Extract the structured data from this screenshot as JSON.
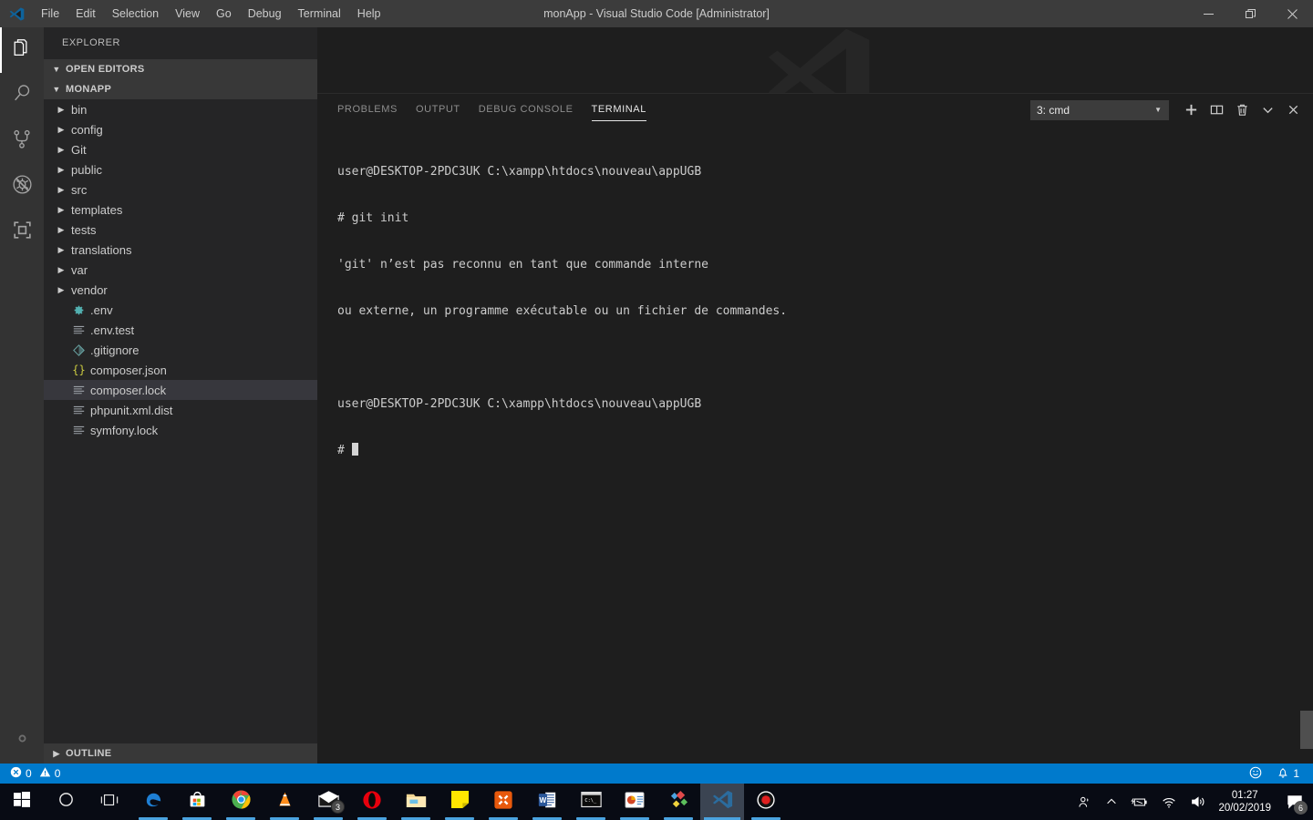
{
  "titlebar": {
    "title": "monApp - Visual Studio Code [Administrator]",
    "logo_icon": "vscode-logo-icon",
    "menu": [
      {
        "label": "File"
      },
      {
        "label": "Edit"
      },
      {
        "label": "Selection"
      },
      {
        "label": "View"
      },
      {
        "label": "Go"
      },
      {
        "label": "Debug"
      },
      {
        "label": "Terminal"
      },
      {
        "label": "Help"
      }
    ],
    "window_controls": [
      {
        "name": "minimize-button",
        "glyph": "—"
      },
      {
        "name": "maximize-button",
        "glyph": "❐"
      },
      {
        "name": "close-button",
        "glyph": "✕"
      }
    ]
  },
  "activitybar": {
    "items": [
      {
        "name": "explorer",
        "icon": "files-icon",
        "active": true
      },
      {
        "name": "search",
        "icon": "search-icon",
        "active": false
      },
      {
        "name": "source-control",
        "icon": "source-control-icon",
        "active": false
      },
      {
        "name": "debug",
        "icon": "debug-disabled-icon",
        "active": false
      },
      {
        "name": "extensions",
        "icon": "extensions-icon",
        "active": false
      }
    ],
    "settings": {
      "name": "manage-settings",
      "icon": "gear-icon"
    }
  },
  "sidebar": {
    "title": "EXPLORER",
    "open_editors_label": "OPEN EDITORS",
    "project_label": "MONAPP",
    "outline_label": "OUTLINE",
    "tree": [
      {
        "label": "bin",
        "type": "folder",
        "icon": "chevron-right-icon"
      },
      {
        "label": "config",
        "type": "folder",
        "icon": "chevron-right-icon"
      },
      {
        "label": "Git",
        "type": "folder",
        "icon": "chevron-right-icon"
      },
      {
        "label": "public",
        "type": "folder",
        "icon": "chevron-right-icon"
      },
      {
        "label": "src",
        "type": "folder",
        "icon": "chevron-right-icon"
      },
      {
        "label": "templates",
        "type": "folder",
        "icon": "chevron-right-icon"
      },
      {
        "label": "tests",
        "type": "folder",
        "icon": "chevron-right-icon"
      },
      {
        "label": "translations",
        "type": "folder",
        "icon": "chevron-right-icon"
      },
      {
        "label": "var",
        "type": "folder",
        "icon": "chevron-right-icon"
      },
      {
        "label": "vendor",
        "type": "folder",
        "icon": "chevron-right-icon"
      },
      {
        "label": ".env",
        "type": "file",
        "icon": "gear-file-icon",
        "color": "#52b0b0"
      },
      {
        "label": ".env.test",
        "type": "file",
        "icon": "lines-file-icon",
        "color": "#9aa0a6"
      },
      {
        "label": ".gitignore",
        "type": "file",
        "icon": "git-file-icon",
        "color": "#6aa6a6"
      },
      {
        "label": "composer.json",
        "type": "file",
        "icon": "json-file-icon",
        "color": "#cbcb41"
      },
      {
        "label": "composer.lock",
        "type": "file",
        "icon": "lines-file-icon",
        "color": "#9aa0a6",
        "selected": true
      },
      {
        "label": "phpunit.xml.dist",
        "type": "file",
        "icon": "lines-file-icon",
        "color": "#9aa0a6"
      },
      {
        "label": "symfony.lock",
        "type": "file",
        "icon": "lines-file-icon",
        "color": "#9aa0a6"
      }
    ]
  },
  "panel": {
    "tabs": [
      {
        "label": "PROBLEMS",
        "active": false
      },
      {
        "label": "OUTPUT",
        "active": false
      },
      {
        "label": "DEBUG CONSOLE",
        "active": false
      },
      {
        "label": "TERMINAL",
        "active": true
      }
    ],
    "terminal_selector": {
      "value": "3: cmd",
      "caret_icon": "chevron-down-icon"
    },
    "actions": [
      {
        "name": "new-terminal-button",
        "icon": "plus-icon"
      },
      {
        "name": "split-terminal-button",
        "icon": "split-icon"
      },
      {
        "name": "kill-terminal-button",
        "icon": "trash-icon"
      },
      {
        "name": "maximize-panel-button",
        "icon": "chevron-down-icon"
      },
      {
        "name": "close-panel-button",
        "icon": "close-icon"
      }
    ],
    "terminal_lines": [
      "user@DESKTOP-2PDC3UK C:\\xampp\\htdocs\\nouveau\\appUGB",
      "# git init",
      "'git' n’est pas reconnu en tant que commande interne",
      "ou externe, un programme exécutable ou un fichier de commandes.",
      "",
      "user@DESKTOP-2PDC3UK C:\\xampp\\htdocs\\nouveau\\appUGB",
      "# "
    ]
  },
  "statusbar": {
    "errors_icon": "error-icon",
    "errors": "0",
    "warnings_icon": "warning-icon",
    "warnings": "0",
    "feedback_icon": "smiley-icon",
    "bell_icon": "bell-icon",
    "notifications": "1",
    "accent_color": "#007acc"
  },
  "taskbar": {
    "items": [
      {
        "name": "start-button",
        "icon": "windows-icon"
      },
      {
        "name": "cortana-search",
        "icon": "circle-icon"
      },
      {
        "name": "task-view",
        "icon": "task-view-icon"
      },
      {
        "name": "edge",
        "icon": "edge-icon",
        "running": true
      },
      {
        "name": "microsoft-store",
        "icon": "store-icon",
        "running": true
      },
      {
        "name": "chrome",
        "icon": "chrome-icon",
        "running": true
      },
      {
        "name": "vlc",
        "icon": "vlc-icon",
        "running": true
      },
      {
        "name": "mail",
        "icon": "mail-icon",
        "running": true,
        "badge": "3"
      },
      {
        "name": "opera",
        "icon": "opera-icon",
        "running": true
      },
      {
        "name": "file-explorer",
        "icon": "folder-icon",
        "running": true
      },
      {
        "name": "sticky-notes",
        "icon": "sticky-note-icon",
        "running": true
      },
      {
        "name": "xampp",
        "icon": "xampp-icon",
        "running": true
      },
      {
        "name": "word",
        "icon": "word-icon",
        "running": true
      },
      {
        "name": "command-prompt",
        "icon": "cmd-icon",
        "running": true
      },
      {
        "name": "powerpoint",
        "icon": "powerpoint-icon",
        "running": true
      },
      {
        "name": "paint-3d",
        "icon": "diamond-icon",
        "running": true
      },
      {
        "name": "visual-studio-code",
        "icon": "vscode-icon",
        "active": true
      },
      {
        "name": "screen-recorder",
        "icon": "record-icon",
        "running": true
      }
    ],
    "tray": {
      "people_icon": "people-icon",
      "chevron_icon": "chevron-up-icon",
      "power_icon": "battery-icon",
      "network_icon": "wifi-icon",
      "volume_icon": "speaker-icon",
      "time": "01:27",
      "date": "20/02/2019",
      "action_center_icon": "notification-icon",
      "action_center_badge": "6"
    }
  }
}
